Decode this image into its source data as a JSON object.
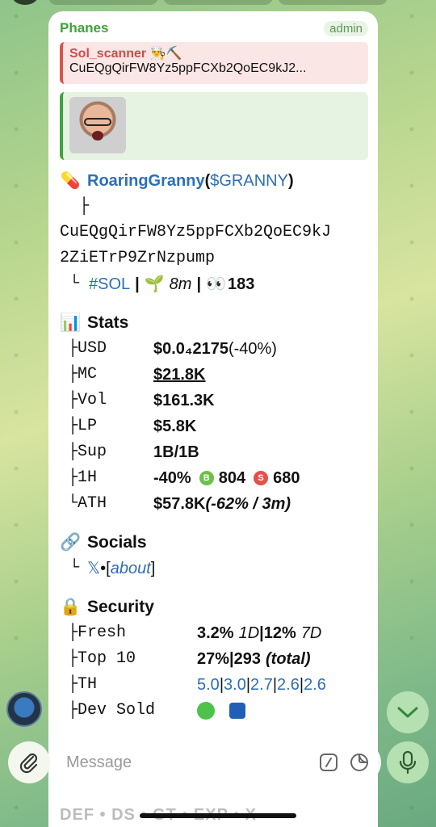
{
  "message": {
    "sender": "Phanes",
    "role_badge": "admin",
    "reply": {
      "name": "Sol_scanner 👨‍🍳⛏️",
      "text": "CuEQgQirFW8Yz5ppFCXb2QoEC9kJ2..."
    },
    "token": {
      "pill_emoji": "💊",
      "name": "RoaringGranny",
      "ticker_open": " (",
      "ticker": "$GRANNY",
      "ticker_close": ")",
      "tree_top": "├",
      "address_line1": "CuEQgQirFW8Yz5ppFCXb2QoEC9kJ",
      "address_line2": "2ZiETrP9ZrNzpump",
      "tree_end": "└",
      "chain": "#SOL",
      "sep": "|",
      "age_emoji": "🌱",
      "age": "8m",
      "views_emoji": "👀",
      "views": "183"
    },
    "stats": {
      "emoji": "📊",
      "title": "Stats",
      "rows": [
        {
          "tree": "├",
          "label": "USD",
          "value": "$0.0₄2175",
          "extra": " (-40%)"
        },
        {
          "tree": "├",
          "label": "MC",
          "value": "$21.8K"
        },
        {
          "tree": "├",
          "label": "Vol",
          "value": "$161.3K"
        },
        {
          "tree": "├",
          "label": "LP",
          "value": "$5.8K"
        },
        {
          "tree": "├",
          "label": "Sup",
          "value": "1B/1B"
        },
        {
          "tree": "├",
          "label": "1H",
          "value": "-40%",
          "buy_badge": "B",
          "buys": "804",
          "sell_badge": "S",
          "sells": "680"
        },
        {
          "tree": "└",
          "label": "ATH",
          "value": "$57.8K",
          "extra": " (-62% / 3m)"
        }
      ]
    },
    "socials": {
      "emoji": "🔗",
      "title": "Socials",
      "tree": "└",
      "x_icon": "𝕏",
      "bullet": " • ",
      "link_open": "[",
      "link": "about",
      "link_close": "]"
    },
    "security": {
      "emoji": "🔒",
      "title": "Security",
      "fresh": {
        "tree": "├",
        "label": "Fresh",
        "v1": "3.2%",
        "p1": "1D",
        "sep": " | ",
        "v2": "12%",
        "p2": "7D"
      },
      "top10": {
        "tree": "├",
        "label": "Top 10",
        "v1": "27%",
        "sep": " | ",
        "v2": "293",
        "note": "(total)"
      },
      "th": {
        "tree": "├",
        "label": "TH",
        "values": [
          "5.0",
          "3.0",
          "2.7",
          "2.6",
          "2.6"
        ]
      },
      "dev": {
        "tree": "├",
        "label": "Dev Sold"
      }
    },
    "footer_links": "DEF • DS • GT • EXP • X"
  },
  "composer": {
    "placeholder": "Message"
  },
  "colors": {
    "sender": "#3fa33a",
    "reply_accent": "#d9534f",
    "link": "#2c6fb7",
    "buy": "#6cc04a",
    "sell": "#e0534a"
  }
}
